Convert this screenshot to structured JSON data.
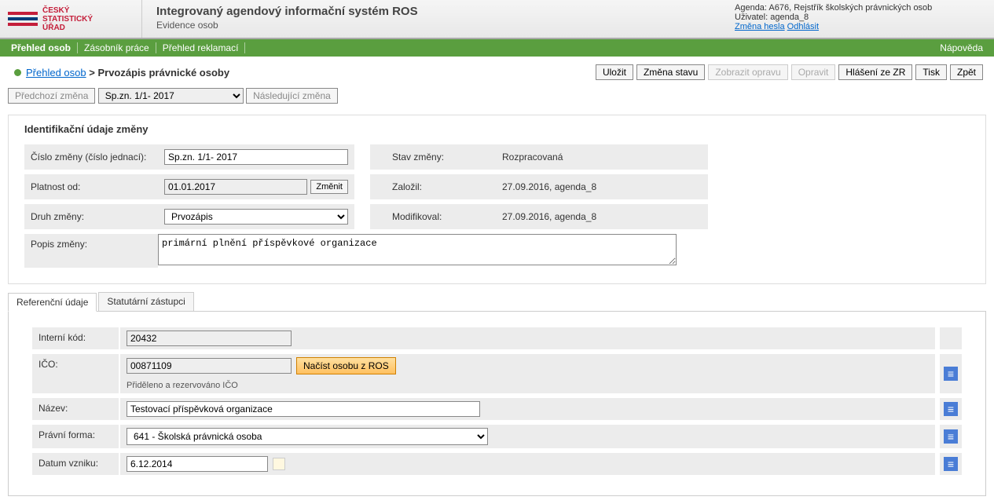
{
  "header": {
    "logo_line1": "ČESKÝ",
    "logo_line2": "STATISTICKÝ",
    "logo_line3": "ÚŘAD",
    "title": "Integrovaný agendový informační systém ROS",
    "subtitle": "Evidence osob",
    "agenda_line": "Agenda: A676, Rejstřík školských právnických osob",
    "user_line": "Uživatel: agenda_8",
    "change_pwd": "Změna hesla",
    "logout": "Odhlásit"
  },
  "menubar": {
    "item1": "Přehled osob",
    "item2": "Zásobník práce",
    "item3": "Přehled reklamací",
    "help": "Nápověda"
  },
  "breadcrumb": {
    "link": "Přehled osob",
    "sep": ">",
    "current": "Prvozápis právnické osoby"
  },
  "toolbar": {
    "save": "Uložit",
    "state_change": "Změna stavu",
    "show_fix": "Zobrazit opravu",
    "fix": "Opravit",
    "zr_report": "Hlášení ze ZR",
    "print": "Tisk",
    "back": "Zpět"
  },
  "nav": {
    "prev": "Předchozí změna",
    "selected": "Sp.zn. 1/1- 2017",
    "next": "Následující změna"
  },
  "ident": {
    "title": "Identifikační údaje změny",
    "number_lbl": "Číslo změny (číslo jednací):",
    "number_val": "Sp.zn. 1/1- 2017",
    "validfrom_lbl": "Platnost od:",
    "validfrom_val": "01.01.2017",
    "change_btn": "Změnit",
    "type_lbl": "Druh změny:",
    "type_val": "Prvozápis",
    "state_lbl": "Stav změny:",
    "state_val": "Rozpracovaná",
    "created_lbl": "Založil:",
    "created_val": "27.09.2016, agenda_8",
    "modified_lbl": "Modifikoval:",
    "modified_val": "27.09.2016, agenda_8",
    "desc_lbl": "Popis změny:",
    "desc_val": "primární plnění příspěvkové organizace"
  },
  "tabs": {
    "tab1": "Referenční údaje",
    "tab2": "Statutární zástupci"
  },
  "ref": {
    "internal_lbl": "Interní kód:",
    "internal_val": "20432",
    "ico_lbl": "IČO:",
    "ico_val": "00871109",
    "load_btn": "Načíst osobu z ROS",
    "ico_note": "Přiděleno a rezervováno IČO",
    "name_lbl": "Název:",
    "name_val": "Testovací příspěvková organizace",
    "form_lbl": "Právní forma:",
    "form_val": "641 - Školská právnická osoba",
    "date_lbl": "Datum vzniku:",
    "date_val": "6.12.2014"
  }
}
